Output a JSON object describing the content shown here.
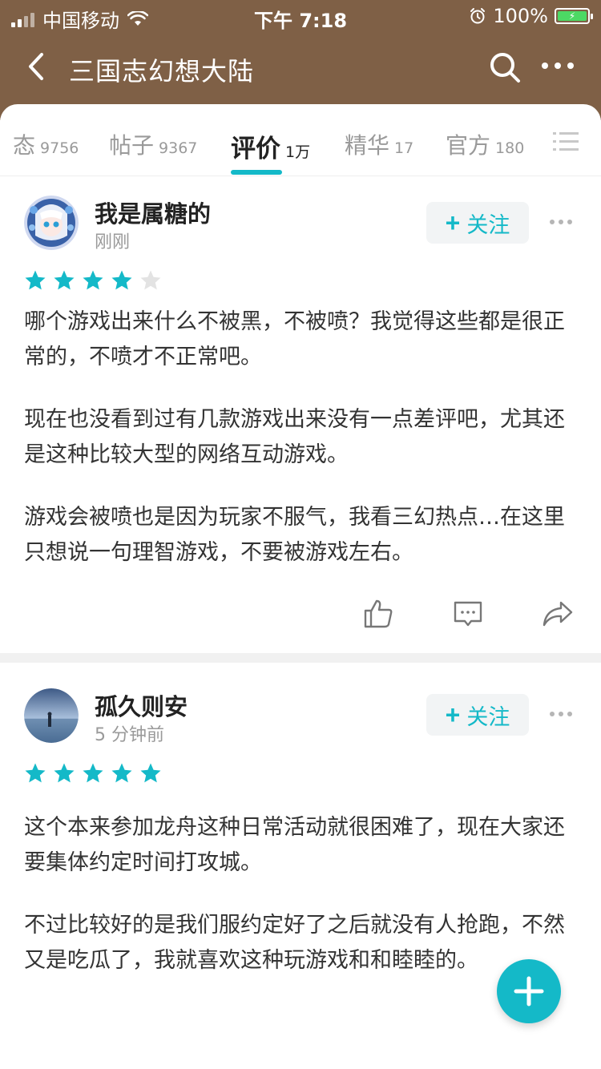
{
  "status_bar": {
    "carrier": "中国移动",
    "time": "下午 7:18",
    "battery": "100%"
  },
  "nav": {
    "title": "三国志幻想大陆",
    "back_icon": "chevron-left-icon",
    "search_icon": "search-icon",
    "more_icon": "more-horizontal-icon"
  },
  "tabs": [
    {
      "label": "态",
      "count": "9756"
    },
    {
      "label": "帖子",
      "count": "9367"
    },
    {
      "label": "评价",
      "count": "1万",
      "active": true
    },
    {
      "label": "精华",
      "count": "17"
    },
    {
      "label": "官方",
      "count": "180"
    }
  ],
  "colors": {
    "header": "#7f6046",
    "accent": "#14b9c8",
    "star_active": "#14b9c8",
    "star_inactive": "#e3e3e3"
  },
  "posts": [
    {
      "username": "我是属糖的",
      "time": "刚刚",
      "follow_label": "关注",
      "rating": 4,
      "paragraphs": [
        "哪个游戏出来什么不被黑，不被喷？我觉得这些都是很正常的，不喷才不正常吧。",
        "现在也没看到过有几款游戏出来没有一点差评吧，尤其还是这种比较大型的网络互动游戏。",
        "游戏会被喷也是因为玩家不服气，我看三幻热点…在这里只想说一句理智游戏，不要被游戏左右。"
      ]
    },
    {
      "username": "孤久则安",
      "time": "5 分钟前",
      "follow_label": "关注",
      "rating": 5,
      "paragraphs": [
        "这个本来参加龙舟这种日常活动就很困难了，现在大家还要集体约定时间打攻城。",
        "不过比较好的是我们服约定好了之后就没有人抢跑，不然又是吃瓜了，我就喜欢这种玩游戏和和睦睦的。"
      ]
    }
  ]
}
